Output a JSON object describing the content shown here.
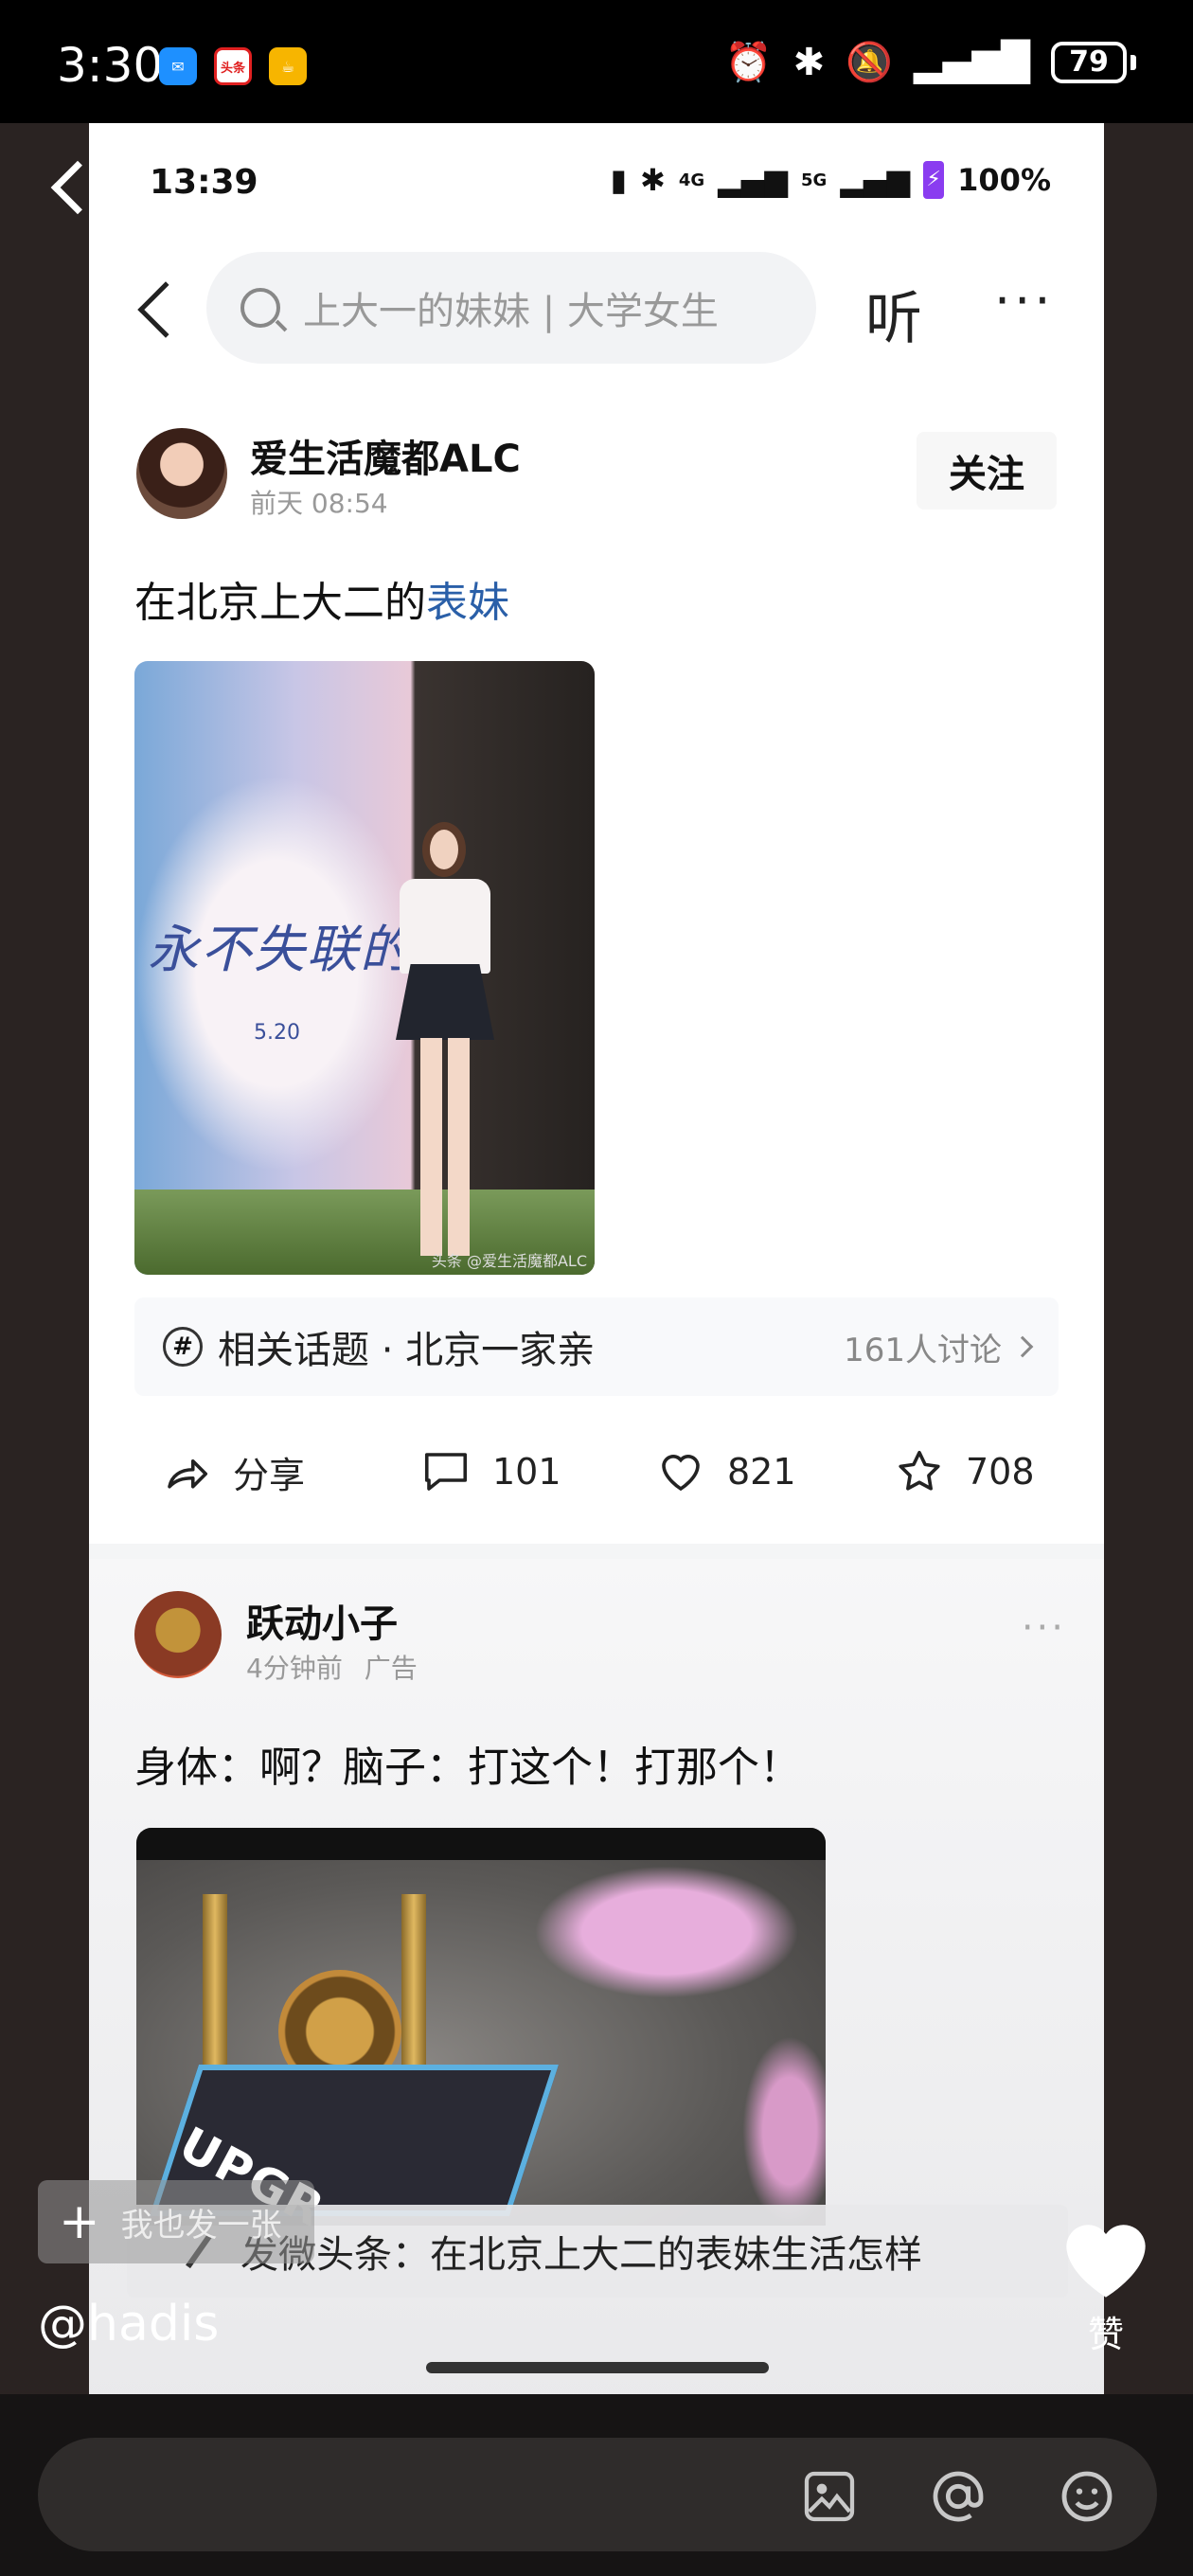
{
  "outer_status": {
    "time": "3:30",
    "battery": "79",
    "apps": [
      "message-icon",
      "toutiao-icon",
      "tea-icon"
    ],
    "toutiao_label": "头条"
  },
  "inner_status": {
    "time": "13:39",
    "network_4g": "4G",
    "network_5g": "5G",
    "battery": "100%"
  },
  "nav": {
    "search_placeholder": "上大一的妹妹 | 大学女生",
    "listen": "听",
    "more": "···"
  },
  "post1": {
    "author": "爱生活魔都ALC",
    "time": "前天  08:54",
    "follow": "关注",
    "text_prefix": "在北京上大二的",
    "text_link": "表妹",
    "photo": {
      "poster_title": "永不失联的爱",
      "poster_date": "5.20",
      "watermark": "头条 @爱生活魔都ALC"
    },
    "topic": {
      "icon": "#",
      "label": "相关话题 · 北京一家亲",
      "count": "161人讨论"
    },
    "actions": {
      "share": "分享",
      "comments": "101",
      "likes": "821",
      "favorites": "708"
    }
  },
  "post2": {
    "author": "跃动小子",
    "time": "4分钟前",
    "ad": "广告",
    "more": "···",
    "text": "身体：啊？脑子：打这个！打那个！",
    "video_label": "UPGR"
  },
  "compose": {
    "label": "发微头条：在北京上大二的表妹生活怎样"
  },
  "overlay": {
    "also_post": "我也发一张",
    "plus": "+",
    "handle": "@hadis",
    "like_label": "赞"
  },
  "bottom_bar": {
    "icons": [
      "image-icon",
      "at-icon",
      "emoji-icon"
    ]
  },
  "colors": {
    "link": "#2a5fa8",
    "charge": "#8a3cf0"
  }
}
